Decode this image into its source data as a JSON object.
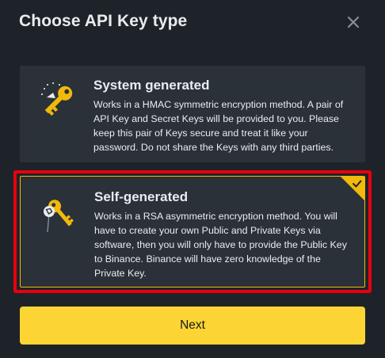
{
  "dialog": {
    "title": "Choose API Key type",
    "close_icon": "close-icon"
  },
  "options": [
    {
      "title": "System generated",
      "description": "Works in a HMAC symmetric encryption method. A pair of API Key and Secret Keys will be provided to you. Please keep this pair of Keys secure and treat it like your password. Do not share the Keys with any third parties.",
      "icon": "key-icon",
      "selected": false
    },
    {
      "title": "Self-generated",
      "description": "Works in a RSA asymmetric encryption method. You will have to create your own Public and Private Keys via software, then you will only have to provide the Public Key to Binance. Binance will have zero knowledge of the Private Key.",
      "icon": "key-pair-icon",
      "selected": true
    }
  ],
  "next_label": "Next",
  "colors": {
    "background": "#1e2329",
    "card": "#2b3139",
    "accent": "#fcd535",
    "selected_border": "#f0b90b",
    "highlight_frame": "#e8000e"
  }
}
